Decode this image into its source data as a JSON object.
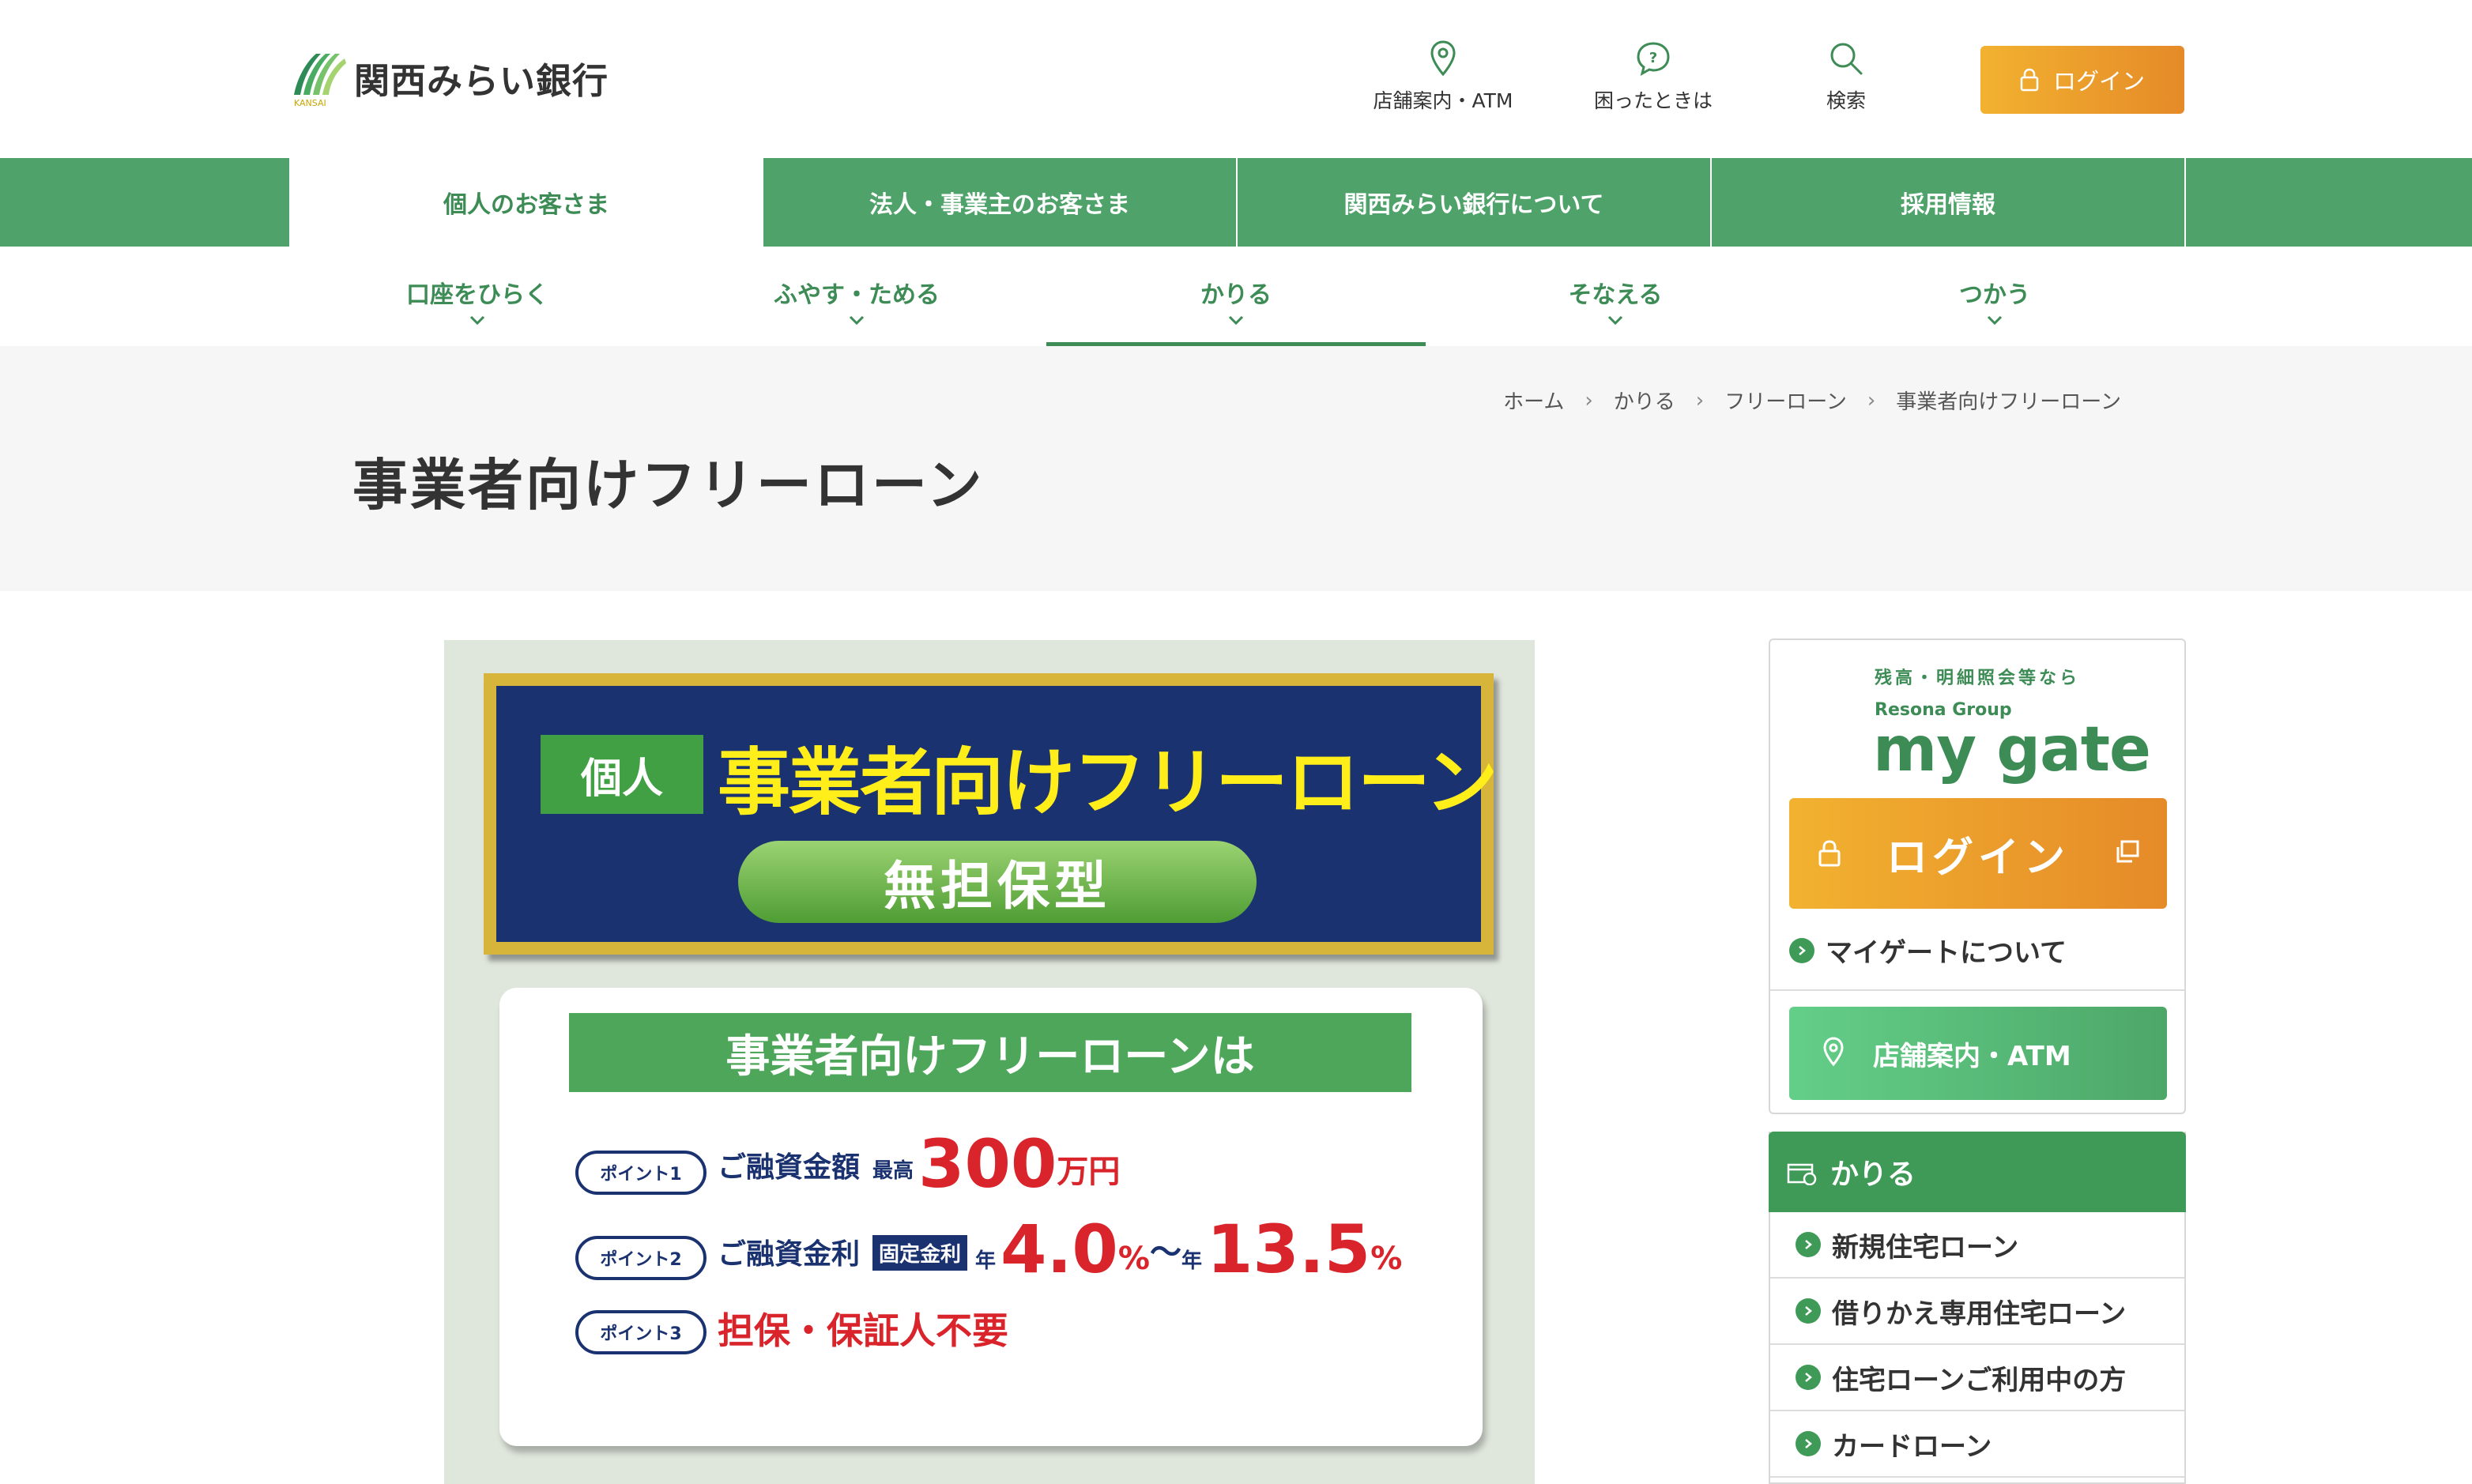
{
  "header": {
    "bank_name": "関西みらい銀行",
    "logo_sub": "KANSAI",
    "util": [
      {
        "label": "店舗案内・ATM",
        "icon": "location-pin-icon"
      },
      {
        "label": "困ったときは",
        "icon": "help-bubble-icon"
      },
      {
        "label": "検索",
        "icon": "search-icon"
      }
    ],
    "login_label": "ログイン"
  },
  "gnav": {
    "items": [
      {
        "label": "個人のお客さま",
        "active": true
      },
      {
        "label": "法人・事業主のお客さま"
      },
      {
        "label": "関西みらい銀行について"
      },
      {
        "label": "採用情報"
      }
    ]
  },
  "subnav": {
    "items": [
      {
        "label": "口座をひらく"
      },
      {
        "label": "ふやす・ためる"
      },
      {
        "label": "かりる",
        "active": true
      },
      {
        "label": "そなえる"
      },
      {
        "label": "つかう"
      }
    ]
  },
  "breadcrumb": [
    "ホーム",
    "かりる",
    "フリーローン",
    "事業者向けフリーローン"
  ],
  "page_title": "事業者向けフリーローン",
  "banner": {
    "tag": "個人",
    "title": "事業者向けフリーローン",
    "pill": "無担保型",
    "card_head": "事業者向けフリーローンは",
    "points": [
      {
        "badge": "ポイント1",
        "label": "ご融資金額",
        "small": "最高",
        "big": "300",
        "unit": "万円"
      },
      {
        "badge": "ポイント2",
        "label": "ご融資金利",
        "box": "固定金利",
        "pre1": "年",
        "rate1": "4.0",
        "pct1": "%",
        "tilde": "〜",
        "pre2": "年",
        "rate2": "13.5",
        "pct2": "%"
      },
      {
        "badge": "ポイント3",
        "text": "担保・保証人不要"
      }
    ]
  },
  "mygate": {
    "small": "残高・明細照会等なら",
    "resona": "Resona Group",
    "logo": "my gate",
    "login_label": "ログイン",
    "about": "マイゲートについて",
    "atm": "店舗案内・ATM"
  },
  "side_nav": {
    "title": "かりる",
    "items": [
      "新規住宅ローン",
      "借りかえ専用住宅ローン",
      "住宅ローンご利用中の方",
      "カードローン"
    ]
  },
  "colors": {
    "brand_green": "#4ea26a",
    "accent_orange": "#e58a28",
    "navy": "#1b3270",
    "red": "#d8242a"
  }
}
